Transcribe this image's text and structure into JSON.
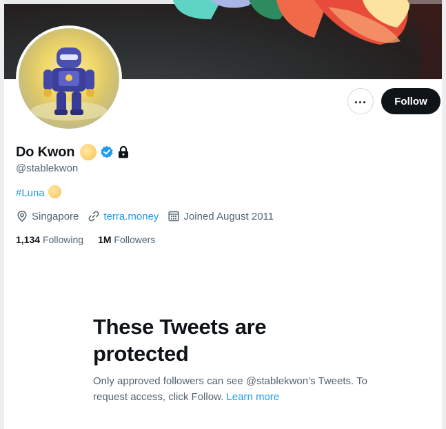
{
  "profile": {
    "display_name": "Do Kwon",
    "handle": "@stablekwon",
    "bio_hashtag": "#Luna",
    "location": "Singapore",
    "website": "terra.money",
    "joined": "Joined August 2011",
    "following_count": "1,134",
    "following_label": "Following",
    "followers_count": "1M",
    "followers_label": "Followers"
  },
  "actions": {
    "more_icon": "more-horizontal-icon",
    "follow_label": "Follow"
  },
  "protected": {
    "title": "These Tweets are protected",
    "description": "Only approved followers can see @stablekwon’s Tweets. To request access, click Follow.",
    "learn_more": "Learn more"
  },
  "colors": {
    "accent": "#1d9bf0",
    "text_primary": "#0f1419",
    "text_secondary": "#536471",
    "follow_bg": "#0f1419"
  },
  "icons": [
    "moon-emoji-icon",
    "verified-badge-icon",
    "lock-icon",
    "location-pin-icon",
    "link-icon",
    "calendar-icon"
  ]
}
